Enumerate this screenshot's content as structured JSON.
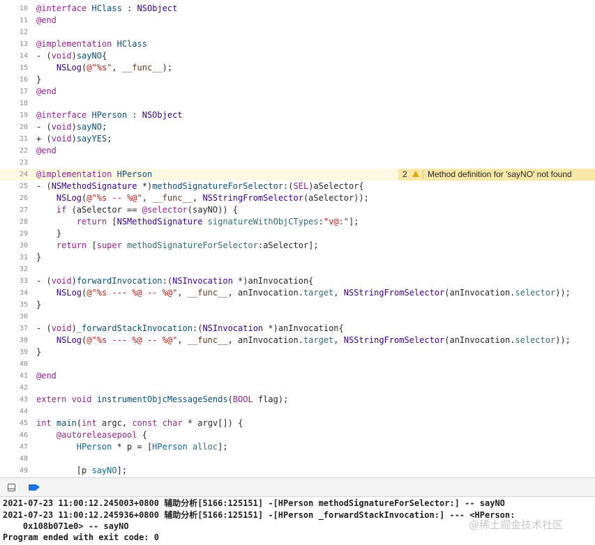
{
  "editor": {
    "lines": [
      {
        "n": "10",
        "segs": [
          [
            "kw",
            "@interface"
          ],
          [
            "",
            ""
          ],
          [
            "df",
            " HClass"
          ],
          [
            "",
            " : "
          ],
          [
            "ty",
            "NSObject"
          ]
        ]
      },
      {
        "n": "11",
        "segs": [
          [
            "kw",
            "@end"
          ]
        ]
      },
      {
        "n": "12",
        "segs": []
      },
      {
        "n": "13",
        "segs": [
          [
            "kw",
            "@implementation"
          ],
          [
            "df",
            " HClass"
          ]
        ]
      },
      {
        "n": "14",
        "segs": [
          [
            "",
            "- ("
          ],
          [
            "kw",
            "void"
          ],
          [
            "",
            ")"
          ],
          [
            "df",
            "sayNO"
          ],
          [
            "",
            "{"
          ]
        ]
      },
      {
        "n": "15",
        "segs": [
          [
            "",
            "    "
          ],
          [
            "ty",
            "NSLog"
          ],
          [
            "",
            "("
          ],
          [
            "st",
            "@\"%s\""
          ],
          [
            "",
            ", "
          ],
          [
            "mc",
            "__func__"
          ],
          [
            "",
            ");"
          ]
        ]
      },
      {
        "n": "16",
        "segs": [
          [
            "",
            "}"
          ]
        ]
      },
      {
        "n": "17",
        "segs": [
          [
            "kw",
            "@end"
          ]
        ]
      },
      {
        "n": "18",
        "segs": []
      },
      {
        "n": "19",
        "segs": [
          [
            "kw",
            "@interface"
          ],
          [
            "df",
            " HPerson"
          ],
          [
            "",
            " : "
          ],
          [
            "ty",
            "NSObject"
          ]
        ]
      },
      {
        "n": "20",
        "segs": [
          [
            "",
            "- ("
          ],
          [
            "kw",
            "void"
          ],
          [
            "",
            ")"
          ],
          [
            "df",
            "sayNO"
          ],
          [
            "",
            ";"
          ]
        ]
      },
      {
        "n": "21",
        "segs": [
          [
            "",
            "+ ("
          ],
          [
            "kw",
            "void"
          ],
          [
            "",
            ")"
          ],
          [
            "df",
            "sayYES"
          ],
          [
            "",
            ";"
          ]
        ]
      },
      {
        "n": "22",
        "segs": [
          [
            "kw",
            "@end"
          ]
        ]
      },
      {
        "n": "23",
        "segs": []
      },
      {
        "n": "24",
        "segs": [
          [
            "kw",
            "@implementation"
          ],
          [
            "df",
            " HPerson"
          ]
        ],
        "issue": true
      },
      {
        "n": "25",
        "segs": [
          [
            "",
            "- ("
          ],
          [
            "ty",
            "NSMethodSignature"
          ],
          [
            "",
            " *)"
          ],
          [
            "df",
            "methodSignatureForSelector"
          ],
          [
            "",
            ":("
          ],
          [
            "kw",
            "SEL"
          ],
          [
            "",
            ")aSelector{"
          ]
        ]
      },
      {
        "n": "26",
        "segs": [
          [
            "",
            "    "
          ],
          [
            "ty",
            "NSLog"
          ],
          [
            "",
            "("
          ],
          [
            "st",
            "@\"%s -- %@\""
          ],
          [
            "",
            ", "
          ],
          [
            "mc",
            "__func__"
          ],
          [
            "",
            ", "
          ],
          [
            "ty",
            "NSStringFromSelector"
          ],
          [
            "",
            "(aSelector));"
          ]
        ]
      },
      {
        "n": "27",
        "segs": [
          [
            "",
            "    "
          ],
          [
            "kw",
            "if"
          ],
          [
            "",
            " (aSelector == "
          ],
          [
            "kw",
            "@selector"
          ],
          [
            "",
            "(sayNO)) {"
          ]
        ]
      },
      {
        "n": "28",
        "segs": [
          [
            "",
            "        "
          ],
          [
            "kw",
            "return"
          ],
          [
            "",
            " ["
          ],
          [
            "ty",
            "NSMethodSignature"
          ],
          [
            "",
            " "
          ],
          [
            "mt",
            "signatureWithObjCTypes"
          ],
          [
            "",
            ":"
          ],
          [
            "st",
            "\"v@:\""
          ],
          [
            "",
            "];"
          ]
        ]
      },
      {
        "n": "29",
        "segs": [
          [
            "",
            "    }"
          ]
        ]
      },
      {
        "n": "30",
        "segs": [
          [
            "",
            "    "
          ],
          [
            "kw",
            "return"
          ],
          [
            "",
            " ["
          ],
          [
            "kw",
            "super"
          ],
          [
            "",
            " "
          ],
          [
            "mt",
            "methodSignatureForSelector"
          ],
          [
            "",
            ":aSelector];"
          ]
        ]
      },
      {
        "n": "31",
        "segs": [
          [
            "",
            "}"
          ]
        ]
      },
      {
        "n": "32",
        "segs": []
      },
      {
        "n": "33",
        "segs": [
          [
            "",
            "- ("
          ],
          [
            "kw",
            "void"
          ],
          [
            "",
            ")"
          ],
          [
            "df",
            "forwardInvocation"
          ],
          [
            "",
            ":("
          ],
          [
            "ty",
            "NSInvocation"
          ],
          [
            "",
            " *)anInvocation{"
          ]
        ]
      },
      {
        "n": "34",
        "segs": [
          [
            "",
            "    "
          ],
          [
            "ty",
            "NSLog"
          ],
          [
            "",
            "("
          ],
          [
            "st",
            "@\"%s --- %@ -- %@\""
          ],
          [
            "",
            ", "
          ],
          [
            "mc",
            "__func__"
          ],
          [
            "",
            ", anInvocation."
          ],
          [
            "mt",
            "target"
          ],
          [
            "",
            ", "
          ],
          [
            "ty",
            "NSStringFromSelector"
          ],
          [
            "",
            "(anInvocation."
          ],
          [
            "mt",
            "selector"
          ],
          [
            "",
            "));"
          ]
        ]
      },
      {
        "n": "35",
        "segs": [
          [
            "",
            "}"
          ]
        ]
      },
      {
        "n": "36",
        "segs": []
      },
      {
        "n": "37",
        "segs": [
          [
            "",
            "- ("
          ],
          [
            "kw",
            "void"
          ],
          [
            "",
            ")"
          ],
          [
            "df",
            "_forwardStackInvocation"
          ],
          [
            "",
            ":("
          ],
          [
            "ty",
            "NSInvocation"
          ],
          [
            "",
            " *)anInvocation{"
          ]
        ]
      },
      {
        "n": "38",
        "segs": [
          [
            "",
            "    "
          ],
          [
            "ty",
            "NSLog"
          ],
          [
            "",
            "("
          ],
          [
            "st",
            "@\"%s --- %@ -- %@\""
          ],
          [
            "",
            ", "
          ],
          [
            "mc",
            "__func__"
          ],
          [
            "",
            ", anInvocation."
          ],
          [
            "mt",
            "target"
          ],
          [
            "",
            ", "
          ],
          [
            "ty",
            "NSStringFromSelector"
          ],
          [
            "",
            "(anInvocation."
          ],
          [
            "mt",
            "selector"
          ],
          [
            "",
            "));"
          ]
        ]
      },
      {
        "n": "39",
        "segs": [
          [
            "",
            "}"
          ]
        ]
      },
      {
        "n": "40",
        "segs": []
      },
      {
        "n": "41",
        "segs": [
          [
            "kw",
            "@end"
          ]
        ]
      },
      {
        "n": "42",
        "segs": []
      },
      {
        "n": "43",
        "segs": [
          [
            "kw",
            "extern"
          ],
          [
            "",
            " "
          ],
          [
            "kw",
            "void"
          ],
          [
            "",
            " "
          ],
          [
            "df",
            "instrumentObjcMessageSends"
          ],
          [
            "",
            "("
          ],
          [
            "kw",
            "BOOL"
          ],
          [
            "",
            " flag);"
          ]
        ]
      },
      {
        "n": "44",
        "segs": []
      },
      {
        "n": "45",
        "segs": [
          [
            "kw",
            "int"
          ],
          [
            "",
            " "
          ],
          [
            "df",
            "main"
          ],
          [
            "",
            "("
          ],
          [
            "kw",
            "int"
          ],
          [
            "",
            " argc, "
          ],
          [
            "kw",
            "const"
          ],
          [
            "",
            " "
          ],
          [
            "kw",
            "char"
          ],
          [
            "",
            " * argv[]) {"
          ]
        ]
      },
      {
        "n": "46",
        "segs": [
          [
            "",
            "    "
          ],
          [
            "kw",
            "@autoreleasepool"
          ],
          [
            "",
            " {"
          ]
        ]
      },
      {
        "n": "47",
        "segs": [
          [
            "",
            "        "
          ],
          [
            "sh",
            "HPerson"
          ],
          [
            "",
            " * p = ["
          ],
          [
            "sh",
            "HPerson"
          ],
          [
            "",
            " "
          ],
          [
            "mt",
            "alloc"
          ],
          [
            "",
            "];"
          ]
        ]
      },
      {
        "n": "48",
        "segs": []
      },
      {
        "n": "49",
        "segs": [
          [
            "",
            "        [p "
          ],
          [
            "sh",
            "sayNO"
          ],
          [
            "",
            "];"
          ]
        ]
      }
    ],
    "issue": {
      "count": "2",
      "icon": "warning-icon",
      "message": "Method definition for 'sayNO' not found"
    }
  },
  "debug_bar": {
    "icons": [
      "panel-toggle-icon",
      "breakpoint-icon"
    ],
    "breakpoint_color": "#1a73e8"
  },
  "console": {
    "lines": [
      "2021-07-23 11:00:12.245003+0800 辅助分析[5166:125151] -[HPerson methodSignatureForSelector:] -- sayNO",
      "2021-07-23 11:00:12.245936+0800 辅助分析[5166:125151] -[HPerson _forwardStackInvocation:] --- <HPerson:",
      "    0x108b071e0> -- sayNO",
      "Program ended with exit code: 0"
    ]
  },
  "watermark": "@稀土掘金技术社区",
  "colors": {
    "keyword": "#9b2393",
    "type": "#3900a0",
    "string": "#c41a16",
    "highlight_line": "#fdf8e1",
    "issue_bg": "#f7e8a8",
    "warning": "#e2a300"
  }
}
